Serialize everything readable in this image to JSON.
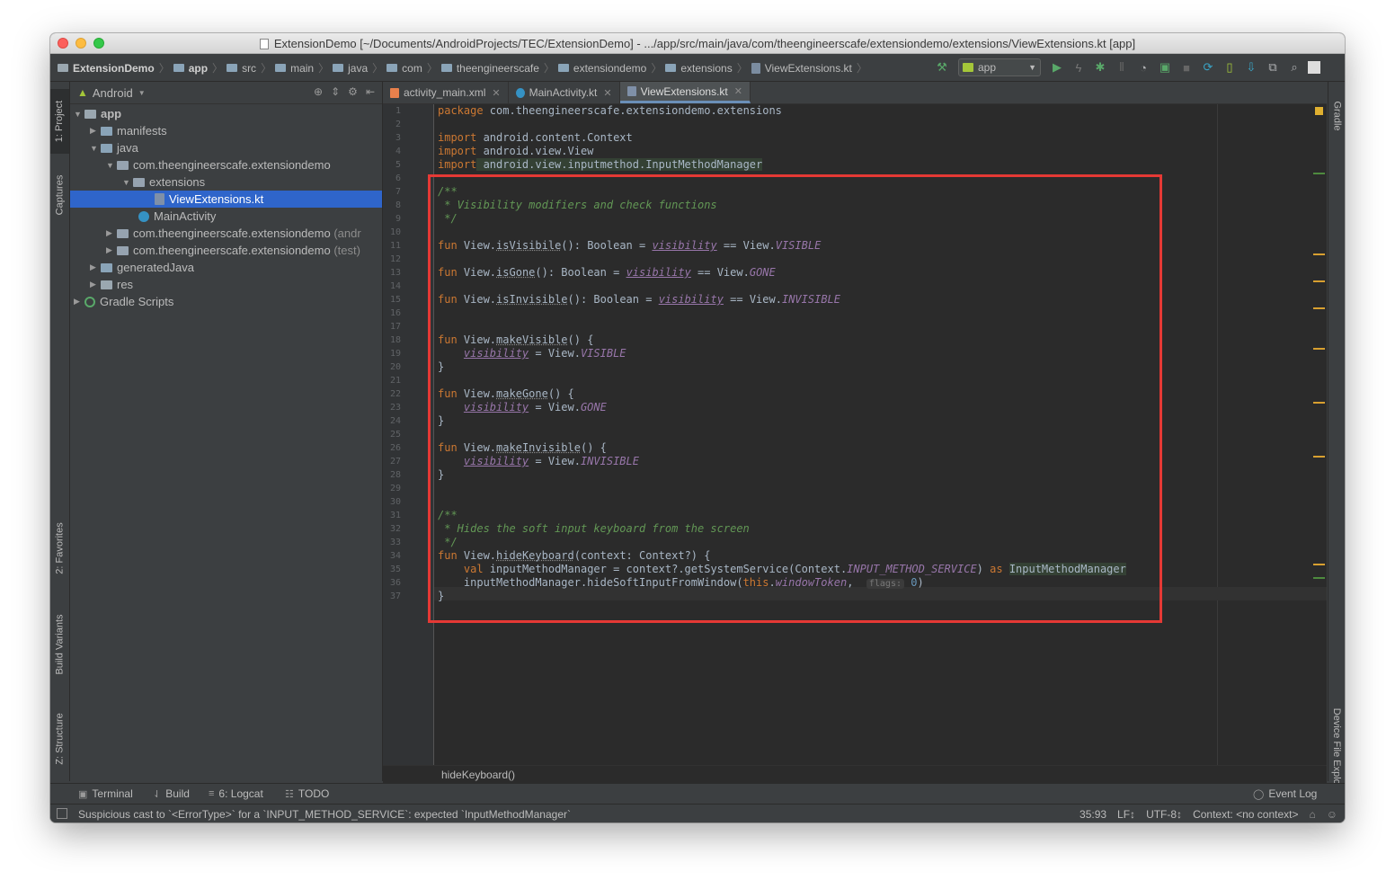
{
  "window": {
    "title": "ExtensionDemo [~/Documents/AndroidProjects/TEC/ExtensionDemo] - .../app/src/main/java/com/theengineerscafe/extensiondemo/extensions/ViewExtensions.kt [app]"
  },
  "breadcrumbs": [
    "ExtensionDemo",
    "app",
    "src",
    "main",
    "java",
    "com",
    "theengineerscafe",
    "extensiondemo",
    "extensions",
    "ViewExtensions.kt"
  ],
  "toolbar": {
    "run_config": "app",
    "icons": [
      "hammer-icon",
      "run-icon",
      "apply-changes-icon",
      "debug-icon",
      "attach-icon",
      "profile-icon",
      "coverage-icon",
      "stop-icon",
      "sync-icon",
      "avd-icon",
      "sdk-icon",
      "layout-inspector-icon",
      "search-icon"
    ]
  },
  "left_tabs": [
    "1: Project",
    "Captures",
    "2: Favorites",
    "Build Variants",
    "Z: Structure"
  ],
  "right_tabs": [
    "Gradle",
    "Device File Explorer"
  ],
  "project": {
    "view": "Android",
    "tree": [
      {
        "label": "app",
        "bold": true
      },
      {
        "label": "manifests"
      },
      {
        "label": "java"
      },
      {
        "label": "com.theengineerscafe.extensiondemo"
      },
      {
        "label": "extensions"
      },
      {
        "label": "ViewExtensions.kt"
      },
      {
        "label": "MainActivity"
      },
      {
        "label": "com.theengineerscafe.extensiondemo",
        "suffix": "(andr"
      },
      {
        "label": "com.theengineerscafe.extensiondemo",
        "suffix": "(test)"
      },
      {
        "label": "generatedJava"
      },
      {
        "label": "res"
      },
      {
        "label": "Gradle Scripts"
      }
    ]
  },
  "editor": {
    "tabs": [
      {
        "label": "activity_main.xml",
        "color": "#e8804c"
      },
      {
        "label": "MainActivity.kt",
        "color": "#3592c4"
      },
      {
        "label": "ViewExtensions.kt",
        "color": "#7f90a8",
        "active": true
      }
    ],
    "line_numbers": [
      "1",
      "2",
      "3",
      "4",
      "5",
      "6",
      "7",
      "8",
      "9",
      "10",
      "11",
      "12",
      "13",
      "14",
      "15",
      "16",
      "17",
      "18",
      "19",
      "20",
      "21",
      "22",
      "23",
      "24",
      "25",
      "26",
      "27",
      "28",
      "29",
      "30",
      "31",
      "32",
      "33",
      "34",
      "35",
      "36",
      "37"
    ],
    "code": {
      "l1_kw": "package",
      "l1_rest": " com.theengineerscafe.extensiondemo.extensions",
      "l3_kw": "import",
      "l3_rest": " android.content.Context",
      "l4_kw": "import",
      "l4_rest": " android.view.View",
      "l5_kw": "import",
      "l5_rest": " android.view.inputmethod.InputMethodManager",
      "l7": "/**",
      "l8": " * Visibility modifiers and check functions",
      "l9": " */",
      "fun": "fun",
      "view_dot": " View.",
      "is_visible": "isVisibile",
      "is_gone": "isGone",
      "is_invisible": "isInvisible",
      "bool_eq": "(): Boolean = ",
      "eq": " = ",
      "visibility": "visibility",
      "eqeq_view": " == View.",
      "visible": "VISIBLE",
      "gone": "GONE",
      "invisible": "INVISIBLE",
      "make_visible": "makeVisible",
      "make_gone": "makeGone",
      "make_invisible": "makeInvisible",
      "parens_brace": "() {",
      "indent": "    ",
      "assign_view": " = View.",
      "close_brace": "}",
      "l31": "/**",
      "l32": " * Hides the soft input keyboard from the screen",
      "l33": " */",
      "hide_keyboard": "hideKeyboard",
      "l34_params": "(context: Context?) {",
      "l35_kw_val": "val",
      "l35_mid": " inputMethodManager = context?.getSystemService(Context.",
      "l35_const": "INPUT_METHOD_SERVICE",
      "l35_close": ") ",
      "l35_as": "as",
      "l35_sp": " ",
      "l35_type": "InputMethodManager",
      "l36_start": "    inputMethodManager.hideSoftInputFromWindow(",
      "l36_this": "this",
      "l36_dot": ".",
      "l36_prop": "windowToken",
      "l36_comma": ",  ",
      "l36_hint": "flags:",
      "l36_sp": " ",
      "l36_zero": "0",
      "l36_end": ")"
    },
    "breadcrumb": "hideKeyboard()"
  },
  "bottom_tools": [
    {
      "label": "Terminal",
      "icon": "terminal-icon"
    },
    {
      "label": "Build",
      "icon": "build-icon"
    },
    {
      "label": "6: Logcat",
      "icon": "logcat-icon"
    },
    {
      "label": "TODO",
      "icon": "todo-icon"
    }
  ],
  "event_log": "Event Log",
  "status": {
    "message": "Suspicious cast to `<ErrorType>` for a `INPUT_METHOD_SERVICE`: expected `InputMethodManager`",
    "position": "35:93",
    "line_sep": "LF↕",
    "encoding": "UTF-8↕",
    "context": "Context: <no context>"
  },
  "colors": {
    "accent_red": "#e53935",
    "selection": "#2f65ca",
    "editor_bg": "#2b2b2b"
  }
}
